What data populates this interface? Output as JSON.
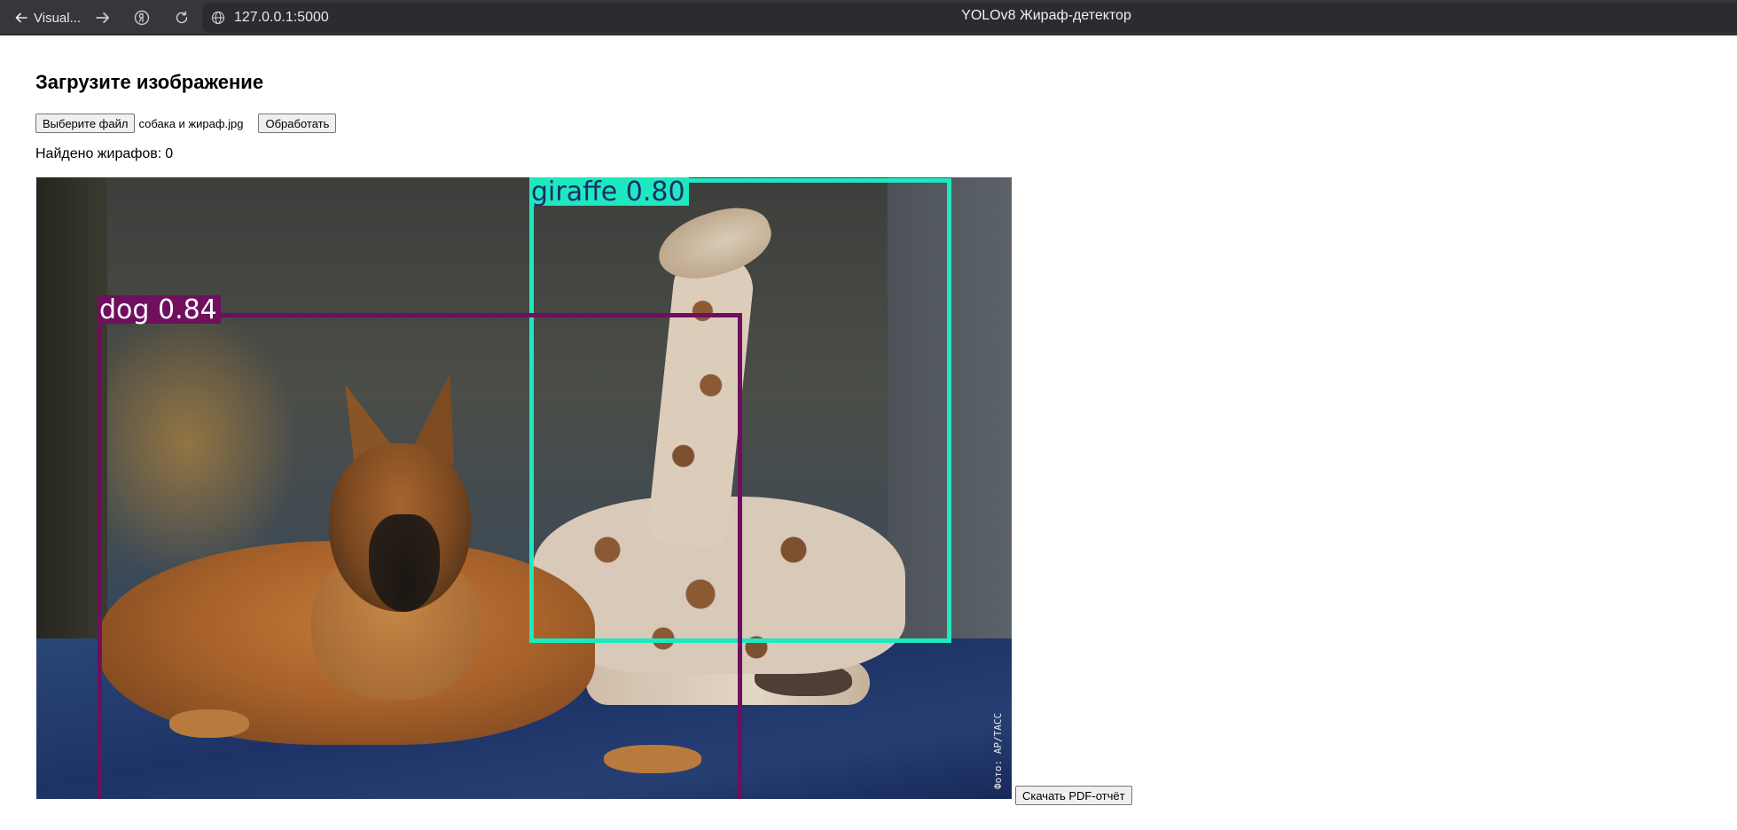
{
  "browser": {
    "back_label": "Visual...",
    "url": "127.0.0.1:5000",
    "page_title": "YOLOv8 Жираф-детектор"
  },
  "page": {
    "heading": "Загрузите изображение",
    "choose_file_label": "Выберите файл",
    "file_name": "собака и жираф.jpg",
    "process_label": "Обработать",
    "giraffe_count_label": "Найдено жирафов:",
    "giraffe_count": "0",
    "download_pdf_label": "Скачать PDF-отчёт"
  },
  "result_image": {
    "detections": [
      {
        "label": "giraffe 0.80",
        "class": "giraffe",
        "confidence": 0.8,
        "color": "#1de9c0"
      },
      {
        "label": "dog 0.84",
        "class": "dog",
        "confidence": 0.84,
        "color": "#6f0f5e"
      }
    ],
    "photo_credit": "Фото: AP/ТАСС"
  },
  "colors": {
    "browser_bar": "#36373d",
    "page_background": "#ffffff"
  }
}
